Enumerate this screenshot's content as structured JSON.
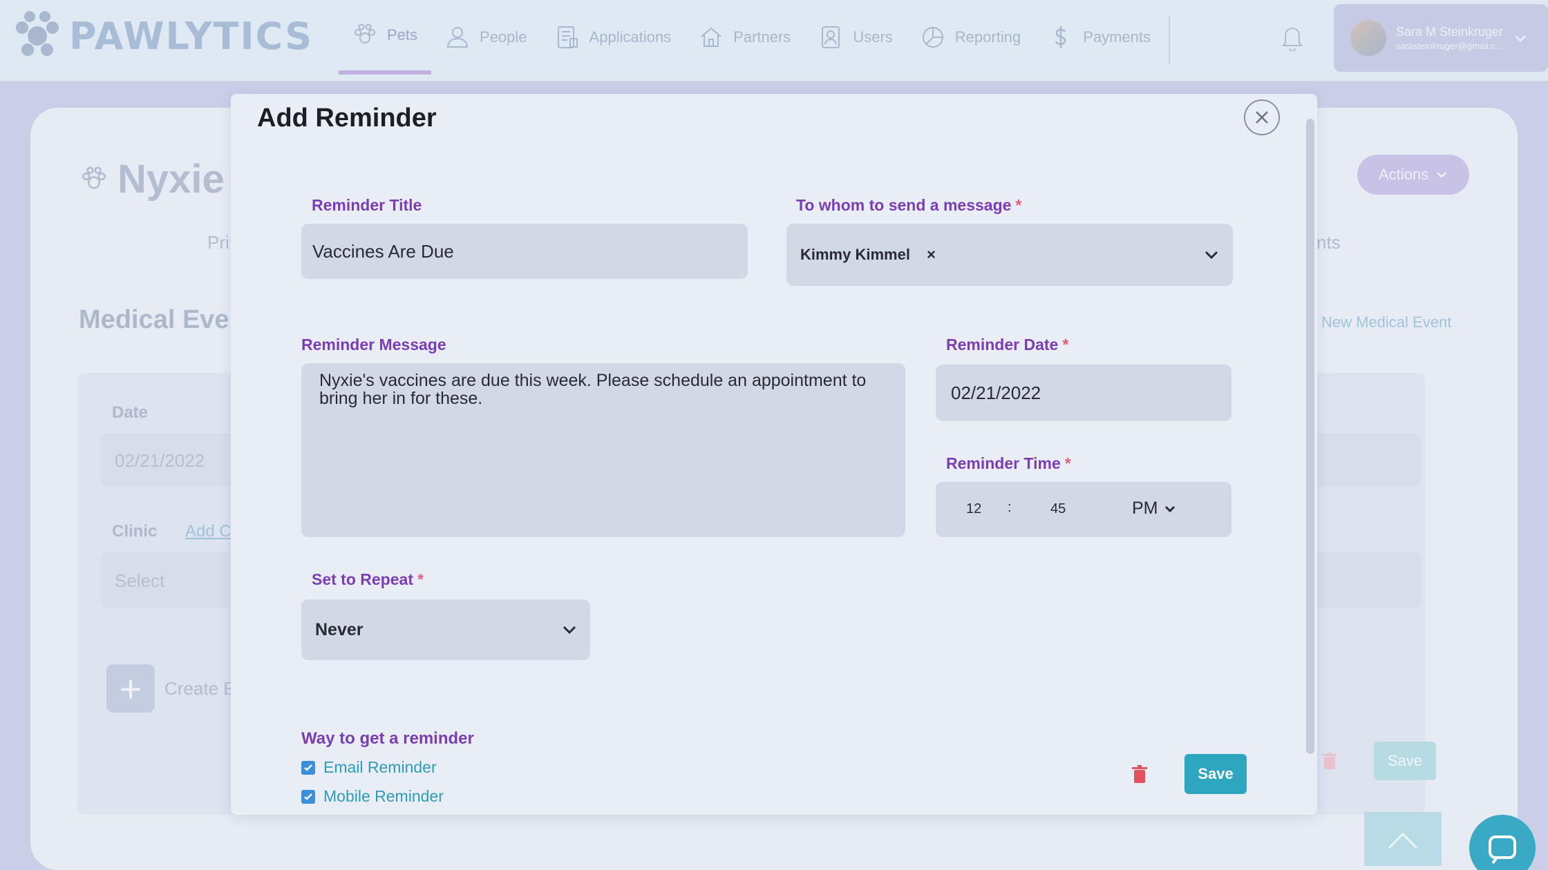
{
  "app": {
    "name": "PAWLYTICS"
  },
  "nav": {
    "items": [
      {
        "label": "Pets",
        "icon": "paw-icon"
      },
      {
        "label": "People",
        "icon": "people-icon"
      },
      {
        "label": "Applications",
        "icon": "applications-icon"
      },
      {
        "label": "Partners",
        "icon": "home-icon"
      },
      {
        "label": "Users",
        "icon": "user-badge-icon"
      },
      {
        "label": "Reporting",
        "icon": "chart-icon"
      },
      {
        "label": "Payments",
        "icon": "dollar-icon"
      }
    ],
    "active": "Pets"
  },
  "user": {
    "name": "Sara M Steinkruger",
    "email": "sarasteinkruger@gmail.c..."
  },
  "background": {
    "pet_name": "Nyxie",
    "tab_left": "Pri",
    "tab_right": "nts",
    "section_title": "Medical Even",
    "date_label": "Date",
    "date_value": "02/21/2022",
    "clinic_label": "Clinic",
    "clinic_add": "Add C",
    "select_placeholder": "Select",
    "create_label": "Create E",
    "actions_label": "Actions",
    "new_event_link": "New Medical Event",
    "save_label": "Save"
  },
  "modal": {
    "title": "Add Reminder",
    "reminder_title_label": "Reminder Title",
    "reminder_title_value": "Vaccines Are Due",
    "recipient_label": "To whom to send a message",
    "recipient_tag": "Kimmy Kimmel",
    "message_label": "Reminder Message",
    "message_value": "Nyxie's vaccines are due this week. Please schedule an appointment to bring her in for these.",
    "date_label": "Reminder Date",
    "date_value": "02/21/2022",
    "time_label": "Reminder Time",
    "time_hour": "12",
    "time_sep": ":",
    "time_minute": "45",
    "time_ampm": "PM",
    "repeat_label": "Set to Repeat",
    "repeat_value": "Never",
    "way_label": "Way to get a reminder",
    "email_label": "Email Reminder",
    "email_checked": true,
    "mobile_label": "Mobile Reminder",
    "mobile_checked": true,
    "save_label": "Save"
  },
  "colors": {
    "accent_purple": "#7a3db4",
    "required_red": "#e45d7a",
    "teal": "#2fa6c0",
    "trash_red": "#e0525e"
  }
}
